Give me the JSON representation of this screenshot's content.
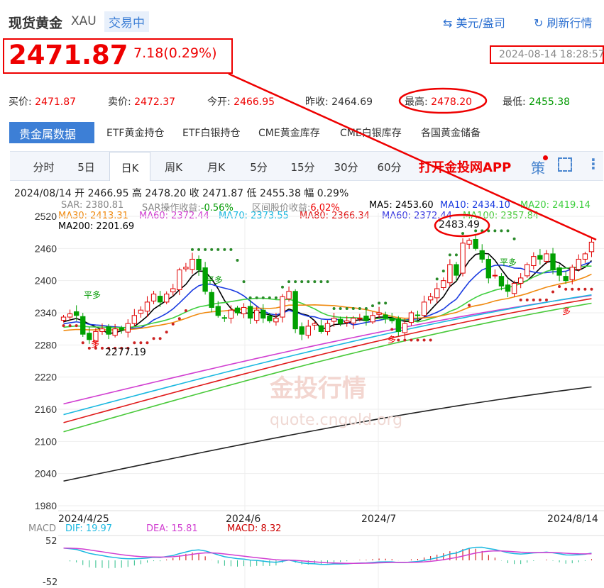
{
  "header": {
    "title": "现货黄金",
    "symbol": "XAU",
    "status": "交易中",
    "currency": "美元/盎司",
    "refresh": "刷新行情"
  },
  "quote": {
    "price": "2471.87",
    "change": "7.18(0.29%)",
    "time": "2024-08-14 18:28:57",
    "bid_label": "买价:",
    "bid": "2471.87",
    "ask_label": "卖价:",
    "ask": "2472.37",
    "open_label": "今开:",
    "open": "2466.95",
    "prev_label": "昨收:",
    "prev": "2464.69",
    "high_label": "最高:",
    "high": "2478.20",
    "low_label": "最低:",
    "low": "2455.38"
  },
  "category_tabs": [
    "贵金属数据",
    "ETF黄金持仓",
    "ETF白银持仓",
    "CME黄金库存",
    "CME白银库存",
    "各国黄金储备"
  ],
  "period_tabs": [
    "分时",
    "5日",
    "日K",
    "周K",
    "月K",
    "5分",
    "15分",
    "30分",
    "60分"
  ],
  "selected_period": "日K",
  "toolbar": {
    "app_link": "打开金投网APP",
    "strategy": "策",
    "more": "⋮"
  },
  "info_line": "2024/08/14  开 2466.95  高 2478.20  收 2471.87  低 2455.38  幅 0.29%",
  "indicators": {
    "sar": "SAR: 2380.81",
    "sar_gain_label": "SAR操作收益:",
    "sar_gain": "-0.56%",
    "range_label": "区间股价收益:",
    "range": "6.02%",
    "ma5": "MA5: 2453.60",
    "ma10": "MA10: 2434.10",
    "ma20": "MA20: 2419.14",
    "ma30": "MA30: 2413.31",
    "ma60": "MA60: 2372.44",
    "ma70": "MA70: 2373.55",
    "ma80": "MA80: 2366.34",
    "ma60b": "MA60: 2372.44",
    "ma100": "MA100: 2357.84",
    "ma200": "MA200: 2201.69"
  },
  "annotations": {
    "max": "2483.49",
    "min": "2277.19",
    "signal_flat": "平多",
    "signal_long": "多"
  },
  "watermark": {
    "brand": "金投行情",
    "url": "quote.cngold.org"
  },
  "macd": {
    "label": "MACD",
    "dif": "DIF: 19.97",
    "dea": "DEA: 15.81",
    "macd": "MACD: 8.32",
    "ymax": "52",
    "ymin": "-52"
  },
  "colors": {
    "up": "#e00000",
    "down": "#00a000",
    "ma5": "#000000",
    "ma10": "#1a3be0",
    "ma20": "#3fcf3f",
    "ma30": "#f08a10",
    "ma60": "#d13fd1",
    "ma70": "#1ab8e0",
    "ma80": "#e01a1a",
    "ma100": "#49c93a",
    "ma200": "#222222"
  },
  "chart_data": {
    "type": "candlestick",
    "y_ticks": [
      "2520",
      "2460",
      "2400",
      "2340",
      "2280",
      "2220",
      "2160",
      "2100",
      "2040",
      "1980"
    ],
    "ylim": [
      1980,
      2520
    ],
    "x_labels": [
      "2024/4/25",
      "2024/6",
      "2024/7",
      "2024/8/14"
    ],
    "closes": [
      2332,
      2338,
      2335,
      2300,
      2290,
      2305,
      2310,
      2300,
      2310,
      2308,
      2320,
      2335,
      2345,
      2360,
      2375,
      2360,
      2375,
      2385,
      2420,
      2425,
      2440,
      2420,
      2380,
      2350,
      2335,
      2330,
      2345,
      2340,
      2350,
      2330,
      2345,
      2330,
      2325,
      2330,
      2370,
      2380,
      2310,
      2300,
      2315,
      2320,
      2305,
      2320,
      2330,
      2320,
      2325,
      2330,
      2330,
      2325,
      2335,
      2340,
      2330,
      2325,
      2305,
      2320,
      2340,
      2335,
      2360,
      2370,
      2385,
      2400,
      2430,
      2410,
      2470,
      2475,
      2460,
      2440,
      2405,
      2410,
      2390,
      2380,
      2395,
      2405,
      2430,
      2445,
      2440,
      2450,
      2420,
      2410,
      2400,
      2425,
      2440,
      2450,
      2471.87
    ],
    "long_ma": {
      "ma60": [
        2170,
        2372.44
      ],
      "ma70": [
        2150,
        2373.55
      ],
      "ma80": [
        2135,
        2366.34
      ],
      "ma100": [
        2118,
        2357.84
      ],
      "ma200": [
        2026,
        2201.69
      ]
    }
  }
}
